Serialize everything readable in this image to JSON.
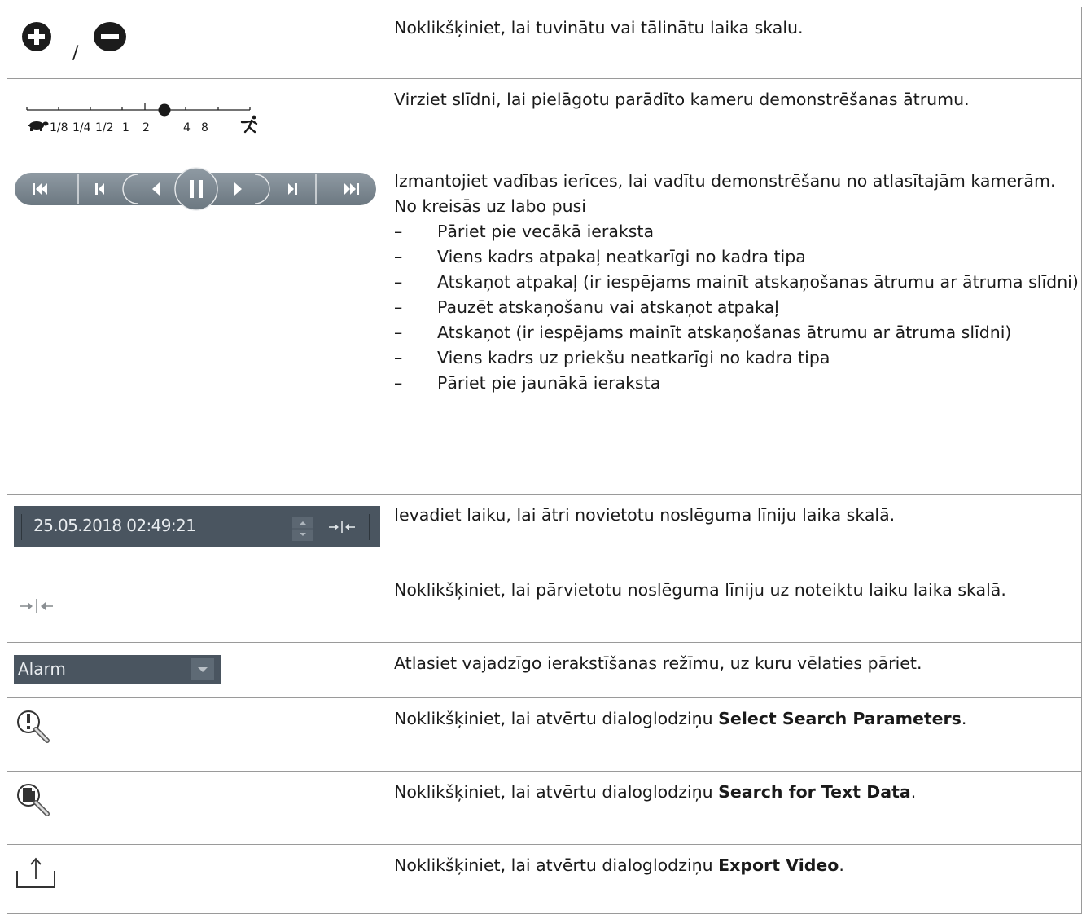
{
  "rows": [
    {
      "icon_names": [
        "zoom-in-icon",
        "zoom-out-icon"
      ],
      "separator": "/",
      "description": "Noklikšķiniet, lai tuvinātu vai tālinātu laika skalu."
    },
    {
      "icon_names": [
        "turtle-icon",
        "runner-icon"
      ],
      "speed_labels": [
        "1/8",
        "1/4",
        "1/2",
        "1",
        "2",
        "4",
        "8"
      ],
      "selected_speed": "2",
      "description": "Virziet slīdni, lai pielāgotu parādīto kameru demonstrēšanas ātrumu."
    },
    {
      "icon_names": [
        "jump-oldest-icon",
        "step-back-icon",
        "play-backward-icon",
        "pause-icon",
        "play-forward-icon",
        "step-forward-icon",
        "jump-newest-icon"
      ],
      "description": "Izmantojiet vadības ierīces, lai vadītu demonstrēšanu no atlasītajām kamerām.",
      "order_note": "No kreisās uz labo pusi",
      "bullet_marker": "–",
      "steps": [
        "Pāriet pie vecākā ieraksta",
        "Viens kadrs atpakaļ neatkarīgi no kadra tipa",
        "Atskaņot atpakaļ (ir iespējams mainīt atskaņošanas ātrumu ar ātruma slīdni)",
        "Pauzēt atskaņošanu vai atskaņot atpakaļ",
        "Atskaņot (ir iespējams mainīt atskaņošanas ātrumu ar ātruma slīdni)",
        "Viens kadrs uz priekšu neatkarīgi no kadra tipa",
        "Pāriet pie jaunākā ieraksta"
      ]
    },
    {
      "datetime_value": "25.05.2018 02:49:21",
      "icon_names": [
        "spin-up-icon",
        "spin-down-icon",
        "move-to-line-icon"
      ],
      "description": "Ievadiet laiku, lai ātri novietotu noslēguma līniju laika skalā."
    },
    {
      "icon_names": [
        "move-to-line-icon"
      ],
      "description": "Noklikšķiniet, lai pārvietotu noslēguma līniju uz noteiktu laiku laika skalā."
    },
    {
      "dropdown_value": "Alarm",
      "icon_names": [
        "chevron-down-icon"
      ],
      "description": "Atlasiet vajadzīgo ierakstīšanas režīmu, uz kuru vēlaties pāriet."
    },
    {
      "icon_names": [
        "search-parameters-icon"
      ],
      "description_prefix": "Noklikšķiniet, lai atvērtu dialoglodziņu ",
      "description_bold": "Select Search Parameters",
      "description_suffix": "."
    },
    {
      "icon_names": [
        "search-text-data-icon"
      ],
      "description_prefix": "Noklikšķiniet, lai atvērtu dialoglodziņu ",
      "description_bold": "Search for Text Data",
      "description_suffix": "."
    },
    {
      "icon_names": [
        "export-icon"
      ],
      "description_prefix": "Noklikšķiniet, lai atvērtu dialoglodziņu ",
      "description_bold": "Export Video",
      "description_suffix": "."
    }
  ]
}
